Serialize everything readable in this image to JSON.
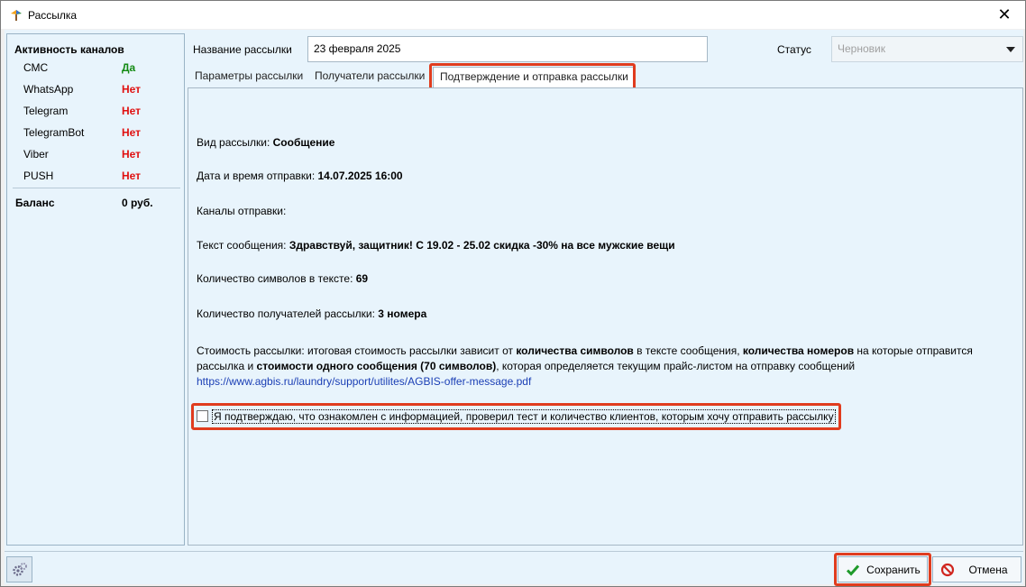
{
  "window": {
    "title": "Рассылка"
  },
  "channels": {
    "heading": "Активность каналов",
    "items": [
      {
        "name": "СМС",
        "value": "Да",
        "color": "#138a13"
      },
      {
        "name": "WhatsApp",
        "value": "Нет",
        "color": "#e01010"
      },
      {
        "name": "Telegram",
        "value": "Нет",
        "color": "#e01010"
      },
      {
        "name": "TelegramBot",
        "value": "Нет",
        "color": "#e01010"
      },
      {
        "name": "Viber",
        "value": "Нет",
        "color": "#e01010"
      },
      {
        "name": "PUSH",
        "value": "Нет",
        "color": "#e01010"
      }
    ],
    "balance_label": "Баланс",
    "balance_value": "0 руб."
  },
  "form": {
    "name_label": "Название рассылки",
    "name_value": "23 февраля 2025",
    "status_label": "Статус",
    "status_value": "Черновик"
  },
  "tabs": [
    {
      "label": "Параметры рассылки"
    },
    {
      "label": "Получатели рассылки"
    },
    {
      "label": "Подтверждение и отправка рассылки",
      "active": true
    }
  ],
  "summary": {
    "type_label": "Вид рассылки: ",
    "type_value": "Сообщение",
    "datetime_label": "Дата и время отправки: ",
    "datetime_value": "14.07.2025 16:00",
    "channels_label": "Каналы отправки:",
    "text_label": "Текст сообщения: ",
    "text_value": "Здравствуй, защитник! С 19.02 - 25.02 скидка -30% на все мужские вещи",
    "chars_label": "Количество символов в тексте: ",
    "chars_value": "69",
    "recipients_label": "Количество получателей рассылки: ",
    "recipients_value": "3 номера",
    "cost_p1": "Стоимость рассылки: итоговая стоимость рассылки зависит от ",
    "cost_b1": "количества символов",
    "cost_p2": " в тексте сообщения, ",
    "cost_b2": "количества номеров",
    "cost_p3": " на которые отправится рассылка и ",
    "cost_b3": "стоимости одного сообщения (70 символов)",
    "cost_p4": ", которая определяется текущим прайс-листом на отправку сообщений",
    "cost_link": "https://www.agbis.ru/laundry/support/utilites/AGBIS-offer-message.pdf"
  },
  "confirm": {
    "text": "Я подтверждаю, что ознакомлен с информацией, проверил тест и количество клиентов, которым хочу отправить рассылку",
    "checked": false
  },
  "buttons": {
    "save": "Сохранить",
    "cancel": "Отмена"
  },
  "icons": {
    "save": "checkmark-icon",
    "cancel": "no-entry-icon",
    "settings": "gears-icon",
    "app": "app-logo-icon"
  }
}
